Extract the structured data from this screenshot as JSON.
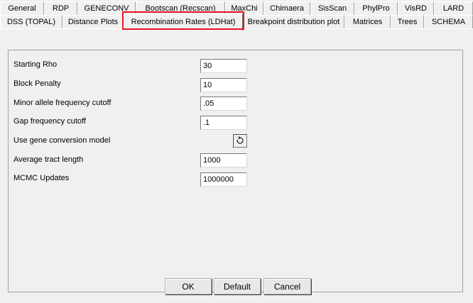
{
  "tabs_back": [
    "General",
    "RDP",
    "GENECONV",
    "Bootscan (Recscan)",
    "MaxChi",
    "Chimaera",
    "SisScan",
    "PhylPro",
    "VisRD",
    "LARD"
  ],
  "tabs_front": [
    "DSS (TOPAL)",
    "Distance Plots",
    "Recombination Rates (LDHat)",
    "Breakpoint distribution plot",
    "Matrices",
    "Trees",
    "SCHEMA"
  ],
  "active_tab": "Recombination Rates (LDHat)",
  "fields": [
    {
      "label": "Starting Rho",
      "value": "30"
    },
    {
      "label": "Block Penalty",
      "value": "10"
    },
    {
      "label": "Minor allele frequency cutoff",
      "value": ".05"
    },
    {
      "label": "Gap frequency cutoff",
      "value": ".1"
    },
    {
      "label": "Use gene conversion model",
      "toggle_icon": "refresh-icon"
    },
    {
      "label": "Average tract length",
      "value": "1000"
    },
    {
      "label": "MCMC Updates",
      "value": "1000000"
    }
  ],
  "buttons": {
    "ok": "OK",
    "default": "Default",
    "cancel": "Cancel"
  },
  "colors": {
    "highlight": "#e8141e",
    "background": "#f0f0f0"
  }
}
